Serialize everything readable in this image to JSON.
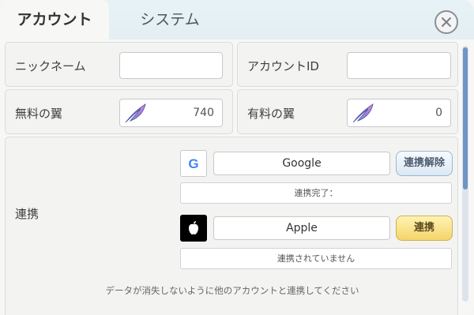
{
  "tabs": [
    {
      "label": "アカウント",
      "active": true
    },
    {
      "label": "システム",
      "active": false
    }
  ],
  "close_icon": "close-icon",
  "account": {
    "nickname": {
      "label": "ニックネーム",
      "value": ""
    },
    "account_id": {
      "label": "アカウントID",
      "value": ""
    },
    "free_wings": {
      "label": "無料の翼",
      "value": "740",
      "icon": "feather-icon"
    },
    "paid_wings": {
      "label": "有料の翼",
      "value": "0",
      "icon": "feather-icon"
    }
  },
  "link": {
    "label": "連携",
    "google": {
      "button_label": "Google",
      "action_label": "連携解除",
      "status": "連携完了："
    },
    "apple": {
      "button_label": "Apple",
      "action_label": "連携",
      "status": "連携されていません"
    },
    "note": "データが消失しないように他のアカウントと連携してください"
  },
  "colors": {
    "accent_blue": "#6f94c6",
    "link_yellow": "#f4d56a",
    "unlink_blue": "#dbe8f4"
  }
}
